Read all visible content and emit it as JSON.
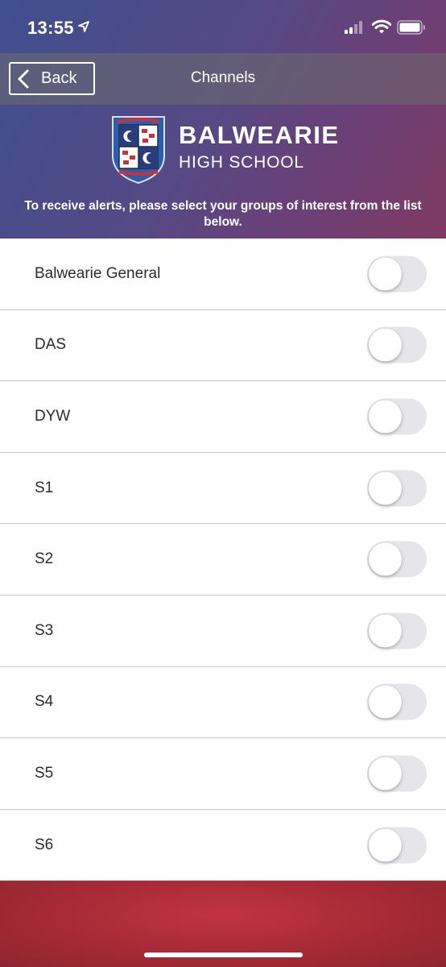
{
  "status_bar": {
    "time": "13:55",
    "icons": [
      "location-arrow-icon",
      "cellular-signal-icon",
      "wifi-icon",
      "battery-icon"
    ]
  },
  "nav": {
    "back_label": "Back",
    "title": "Channels"
  },
  "school": {
    "name": "BALWEARIE",
    "subtitle": "HIGH SCHOOL",
    "crest_icon": "school-crest-icon"
  },
  "instructions": "To receive alerts, please select your groups of interest from the list below.",
  "channels": [
    {
      "label": "Balwearie General",
      "enabled": false
    },
    {
      "label": "DAS",
      "enabled": false
    },
    {
      "label": "DYW",
      "enabled": false
    },
    {
      "label": "S1",
      "enabled": false
    },
    {
      "label": "S2",
      "enabled": false
    },
    {
      "label": "S3",
      "enabled": false
    },
    {
      "label": "S4",
      "enabled": false
    },
    {
      "label": "S5",
      "enabled": false
    },
    {
      "label": "S6",
      "enabled": false
    }
  ],
  "colors": {
    "header_gradient_start": "#3f4f8e",
    "header_gradient_end": "#7f3a60",
    "footer": "#b02e3a",
    "toggle_off": "#e5e5ea"
  }
}
